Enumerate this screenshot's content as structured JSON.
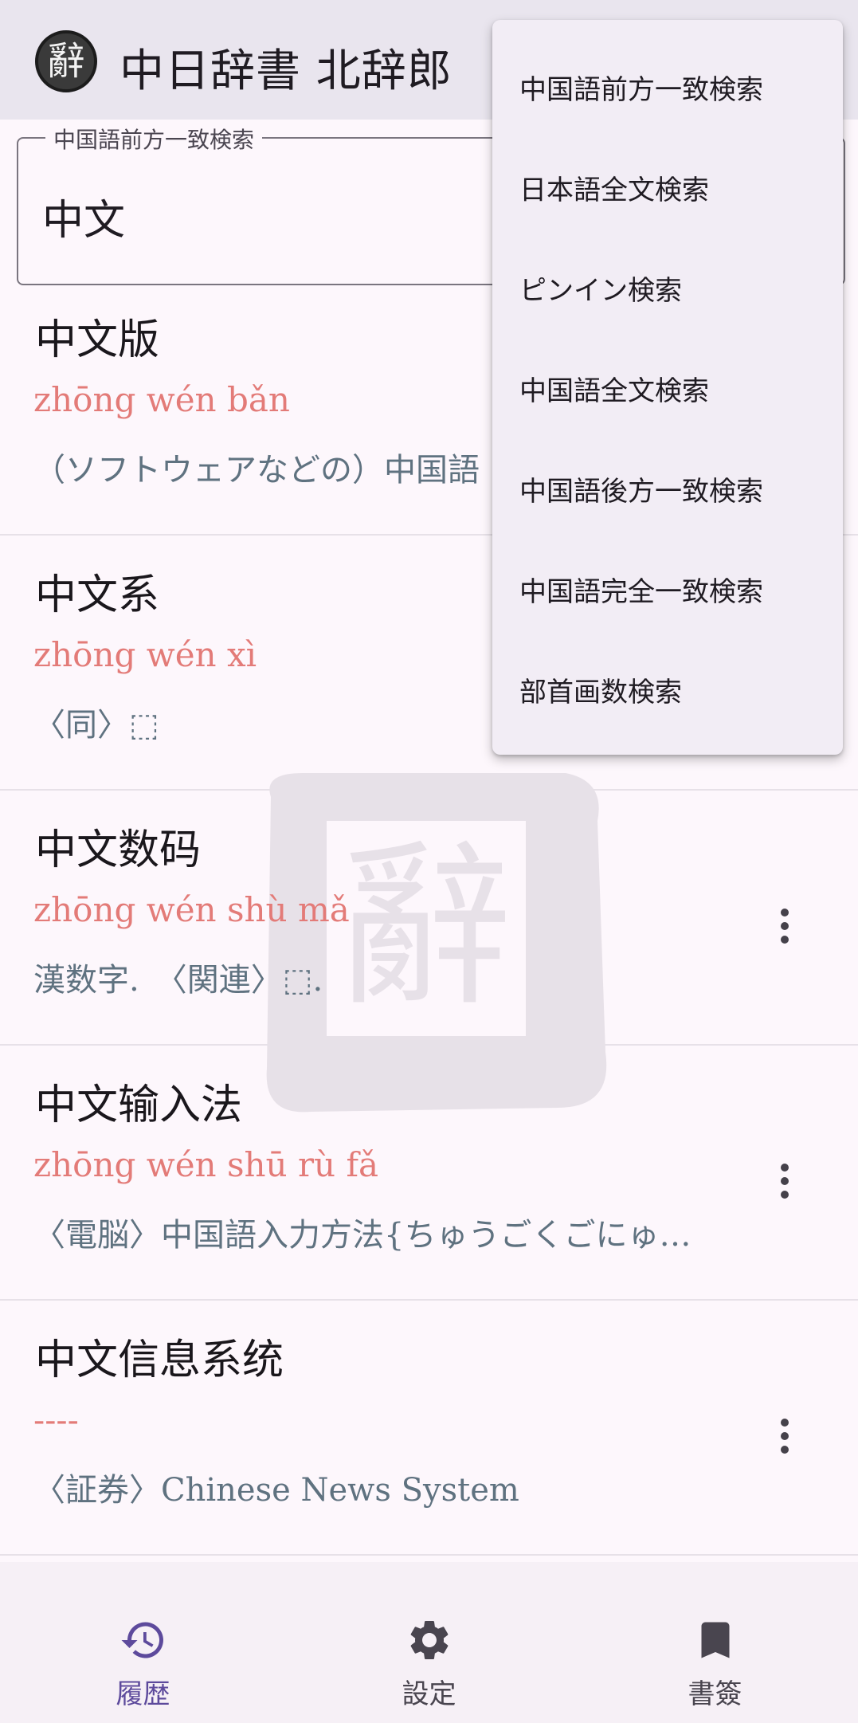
{
  "app": {
    "logo_glyph": "辭",
    "title": "中日辞書 北辞郎"
  },
  "search": {
    "mode_label": "中国語前方一致検索",
    "query": "中文"
  },
  "entries": [
    {
      "word": "中文版",
      "pinyin": "zhōng wén bǎn",
      "definition": "（ソフトウェアなどの）中国語"
    },
    {
      "word": "中文系",
      "pinyin": "zhōng wén xì",
      "definition": "〈同〉⬚"
    },
    {
      "word": "中文数码",
      "pinyin": "zhōng wén shù mǎ",
      "definition": "漢数字.　〈関連〉⬚."
    },
    {
      "word": "中文输入法",
      "pinyin": "zhōng wén shū rù fǎ",
      "definition": "〈電脳〉中国語入力方法{ちゅうごくごにゅ…"
    },
    {
      "word": "中文信息系统",
      "pinyin": "----",
      "definition": "〈証券〉Chinese News System"
    }
  ],
  "search_menu": {
    "items": [
      "中国語前方一致検索",
      "日本語全文検索",
      "ピンイン検索",
      "中国語全文検索",
      "中国語後方一致検索",
      "中国語完全一致検索",
      "部首画数検索"
    ]
  },
  "bottom_nav": {
    "items": [
      {
        "label": "履歴",
        "icon": "history-icon",
        "active": true
      },
      {
        "label": "設定",
        "icon": "gear-icon",
        "active": false
      },
      {
        "label": "書簽",
        "icon": "bookmark-icon",
        "active": false
      }
    ]
  },
  "colors": {
    "pinyin": "#e37b78",
    "definition": "#5f7280",
    "active_nav": "#5d4a9c"
  }
}
